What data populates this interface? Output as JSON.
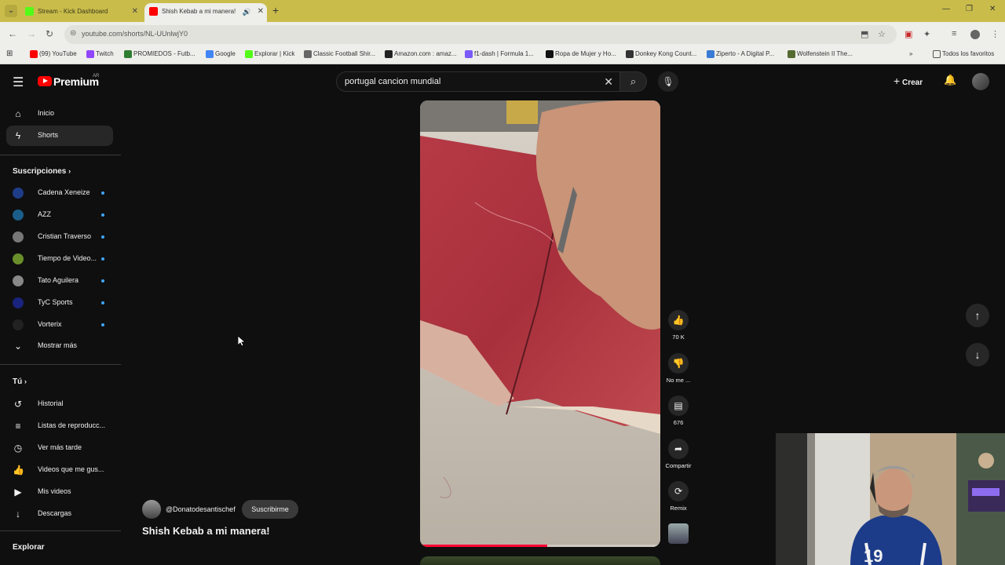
{
  "browser": {
    "tabs": [
      {
        "title": "Stream - Kick Dashboard",
        "favicon_color": "#53fc18",
        "active": false
      },
      {
        "title": "Shish Kebab a mi manera!",
        "favicon_color": "#ff0000",
        "active": true
      }
    ],
    "url": "youtube.com/shorts/NL-UUnlwjY0",
    "bookmarks": [
      {
        "label": "(99) YouTube",
        "color": "#ff0000"
      },
      {
        "label": "Twitch",
        "color": "#9146ff"
      },
      {
        "label": "PROMIEDOS - Futb...",
        "color": "#2e7d32"
      },
      {
        "label": "Google",
        "color": "#4285f4"
      },
      {
        "label": "Explorar | Kick",
        "color": "#53fc18"
      },
      {
        "label": "Classic Football Shir...",
        "color": "#666666"
      },
      {
        "label": "Amazon.com : amaz...",
        "color": "#222222"
      },
      {
        "label": "f1-dash | Formula 1...",
        "color": "#7a5af8"
      },
      {
        "label": "Ropa de Mujer y Ho...",
        "color": "#111111"
      },
      {
        "label": "Donkey Kong Count...",
        "color": "#333333"
      },
      {
        "label": "Ziperto - A Digital P...",
        "color": "#3a7bd5"
      },
      {
        "label": "Wolfenstein II The...",
        "color": "#556b2f"
      }
    ],
    "all_bookmarks": "Todos los favoritos"
  },
  "youtube": {
    "logo_text": "Premium",
    "logo_country": "AR",
    "search_query": "portugal cancion mundial",
    "create_label": "Crear",
    "sidebar": {
      "main": [
        {
          "label": "Inicio",
          "icon": "home-icon",
          "glyph": "⌂",
          "active": false
        },
        {
          "label": "Shorts",
          "icon": "shorts-icon",
          "glyph": "ϟ",
          "active": true
        }
      ],
      "subscriptions_heading": "Suscripciones",
      "subscriptions": [
        {
          "label": "Cadena Xeneize",
          "avatar_color": "#1f3c88"
        },
        {
          "label": "AZZ",
          "avatar_color": "#1b5e8a"
        },
        {
          "label": "Cristian Traverso",
          "avatar_color": "#777777"
        },
        {
          "label": "Tiempo de Video...",
          "avatar_color": "#6a8f2a"
        },
        {
          "label": "Tato Aguilera",
          "avatar_color": "#888888"
        },
        {
          "label": "TyC Sports",
          "avatar_color": "#1a237e"
        },
        {
          "label": "Vorterix",
          "avatar_color": "#222222"
        }
      ],
      "show_more": "Mostrar más",
      "you_heading": "Tú",
      "you_items": [
        {
          "label": "Historial",
          "icon": "history-icon",
          "glyph": "↺"
        },
        {
          "label": "Listas de reproducc...",
          "icon": "playlists-icon",
          "glyph": "≡"
        },
        {
          "label": "Ver más tarde",
          "icon": "watch-later-icon",
          "glyph": "◷"
        },
        {
          "label": "Videos que me gus...",
          "icon": "liked-icon",
          "glyph": "👍"
        },
        {
          "label": "Mis videos",
          "icon": "my-videos-icon",
          "glyph": "▶"
        },
        {
          "label": "Descargas",
          "icon": "downloads-icon",
          "glyph": "↓"
        }
      ],
      "explore_heading": "Explorar"
    },
    "short": {
      "channel_handle": "@Donatodesantischef",
      "subscribe_label": "Suscribirme",
      "title": "Shish Kebab a mi manera!",
      "progress": 0.53,
      "actions": [
        {
          "name": "like-button",
          "icon": "thumbs-up-icon",
          "glyph": "👍",
          "label": "70 K"
        },
        {
          "name": "dislike-button",
          "icon": "thumbs-down-icon",
          "glyph": "👎",
          "label": "No me ..."
        },
        {
          "name": "comments-button",
          "icon": "comment-icon",
          "glyph": "▤",
          "label": "676"
        },
        {
          "name": "share-button",
          "icon": "share-icon",
          "glyph": "➦",
          "label": "Compartir"
        },
        {
          "name": "remix-button",
          "icon": "remix-icon",
          "glyph": "⟳",
          "label": "Remix"
        }
      ]
    }
  }
}
